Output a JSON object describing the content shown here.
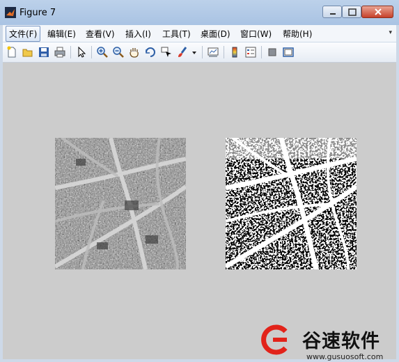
{
  "window": {
    "title": "Figure 7"
  },
  "menubar": {
    "items": [
      {
        "label": "文件(F)",
        "active": true
      },
      {
        "label": "编辑(E)"
      },
      {
        "label": "查看(V)"
      },
      {
        "label": "插入(I)"
      },
      {
        "label": "工具(T)"
      },
      {
        "label": "桌面(D)"
      },
      {
        "label": "窗口(W)"
      },
      {
        "label": "帮助(H)"
      }
    ]
  },
  "toolbar": {
    "icons": [
      "new-figure-icon",
      "open-file-icon",
      "save-icon",
      "print-icon",
      "pointer-icon",
      "zoom-in-icon",
      "zoom-out-icon",
      "pan-hand-icon",
      "rotate-3d-icon",
      "data-cursor-icon",
      "brush-icon",
      "dropdown-arrow-icon",
      "link-plot-icon",
      "colorbar-icon",
      "legend-icon",
      "hide-plot-tools-icon",
      "show-plot-tools-icon"
    ]
  },
  "figure": {
    "images": [
      {
        "type": "grayscale-aerial-image"
      },
      {
        "type": "binary-thresholded-image"
      }
    ]
  },
  "watermark": {
    "name": "谷速软件",
    "url": "www.gusuosoft.com"
  },
  "colors": {
    "canvas": "#cccccc",
    "titlebar": "#b3c9e6",
    "close_button": "#c7412a",
    "watermark_red": "#e2231a"
  }
}
